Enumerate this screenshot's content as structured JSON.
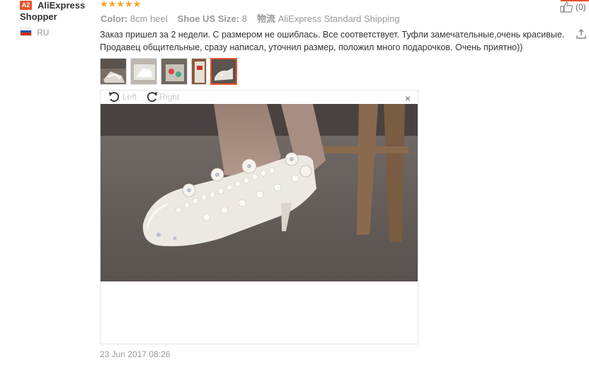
{
  "user": {
    "badge": "A2",
    "name": "AliExpress Shopper",
    "country": "RU"
  },
  "review": {
    "rating_stars": 5,
    "attributes": [
      {
        "label": "Color:",
        "value": "8cm heel"
      },
      {
        "label": "Shoe US Size:",
        "value": "8"
      },
      {
        "label": "物流",
        "value": "AliExpress Standard Shipping"
      }
    ],
    "text": "Заказ пришел за 2 недели. С размером не ошиблась. Все соответствует. Туфли замечательные,очень красивые. Продавец общительные, сразу написал, уточнил размер, положил много подарочков. Очень приятно))",
    "thumbnail_count": 5,
    "selected_thumbnail": 5,
    "date": "23 Jun 2017 08:26",
    "likes": "(0)"
  },
  "viewer": {
    "rotate_left": "Left",
    "rotate_right": "Right",
    "close": "×"
  },
  "icons": {
    "like": "thumbs-up-icon",
    "share": "share-icon",
    "close": "close-icon",
    "rotate_left": "rotate-left-icon",
    "rotate_right": "rotate-right-icon"
  },
  "colors": {
    "accent": "#e8532d",
    "star": "#f5a623",
    "muted": "#999999"
  }
}
